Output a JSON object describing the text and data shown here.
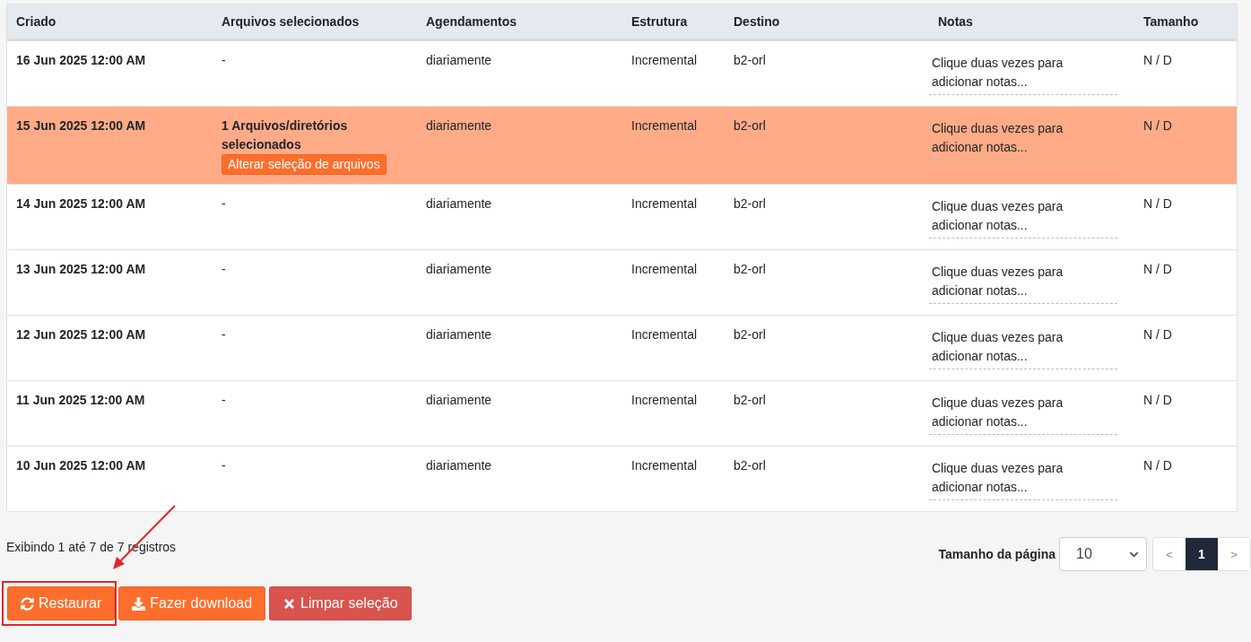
{
  "table": {
    "columns": [
      "Criado",
      "Arquivos selecionados",
      "Agendamentos",
      "Estrutura",
      "Destino",
      "Notas",
      "Tamanho"
    ],
    "rows": [
      {
        "selected": false,
        "created": "16 Jun 2025 12:00 AM",
        "files": "-",
        "schedule": "diariamente",
        "structure": "Incremental",
        "destination": "b2-orl",
        "notes": "Clique duas vezes para adicionar notas...",
        "size": "N / D"
      },
      {
        "selected": true,
        "created": "15 Jun 2025 12:00 AM",
        "files": "1 Arquivos/diretórios selecionados",
        "files_action": "Alterar seleção de arquivos",
        "schedule": "diariamente",
        "structure": "Incremental",
        "destination": "b2-orl",
        "notes": "Clique duas vezes para adicionar notas...",
        "size": "N / D"
      },
      {
        "selected": false,
        "created": "14 Jun 2025 12:00 AM",
        "files": "-",
        "schedule": "diariamente",
        "structure": "Incremental",
        "destination": "b2-orl",
        "notes": "Clique duas vezes para adicionar notas...",
        "size": "N / D"
      },
      {
        "selected": false,
        "created": "13 Jun 2025 12:00 AM",
        "files": "-",
        "schedule": "diariamente",
        "structure": "Incremental",
        "destination": "b2-orl",
        "notes": "Clique duas vezes para adicionar notas...",
        "size": "N / D"
      },
      {
        "selected": false,
        "created": "12 Jun 2025 12:00 AM",
        "files": "-",
        "schedule": "diariamente",
        "structure": "Incremental",
        "destination": "b2-orl",
        "notes": "Clique duas vezes para adicionar notas...",
        "size": "N / D"
      },
      {
        "selected": false,
        "created": "11 Jun 2025 12:00 AM",
        "files": "-",
        "schedule": "diariamente",
        "structure": "Incremental",
        "destination": "b2-orl",
        "notes": "Clique duas vezes para adicionar notas...",
        "size": "N / D"
      },
      {
        "selected": false,
        "created": "10 Jun 2025 12:00 AM",
        "files": "-",
        "schedule": "diariamente",
        "structure": "Incremental",
        "destination": "b2-orl",
        "notes": "Clique duas vezes para adicionar notas...",
        "size": "N / D"
      }
    ]
  },
  "footer": {
    "summary": "Exibindo 1 até 7 de 7 registros",
    "page_size_label": "Tamanho da página",
    "page_size": "10",
    "pages": [
      {
        "kind": "prev",
        "label": "<",
        "selected": false
      },
      {
        "kind": "page",
        "label": "1",
        "selected": true
      },
      {
        "kind": "next",
        "label": ">",
        "selected": false
      }
    ]
  },
  "actions": [
    {
      "kind": "restore",
      "label": "Restaurar",
      "highlighted": true
    },
    {
      "kind": "download",
      "label": "Fazer download",
      "highlighted": false
    },
    {
      "kind": "clear",
      "label": "Limpar seleção",
      "highlighted": false
    }
  ]
}
